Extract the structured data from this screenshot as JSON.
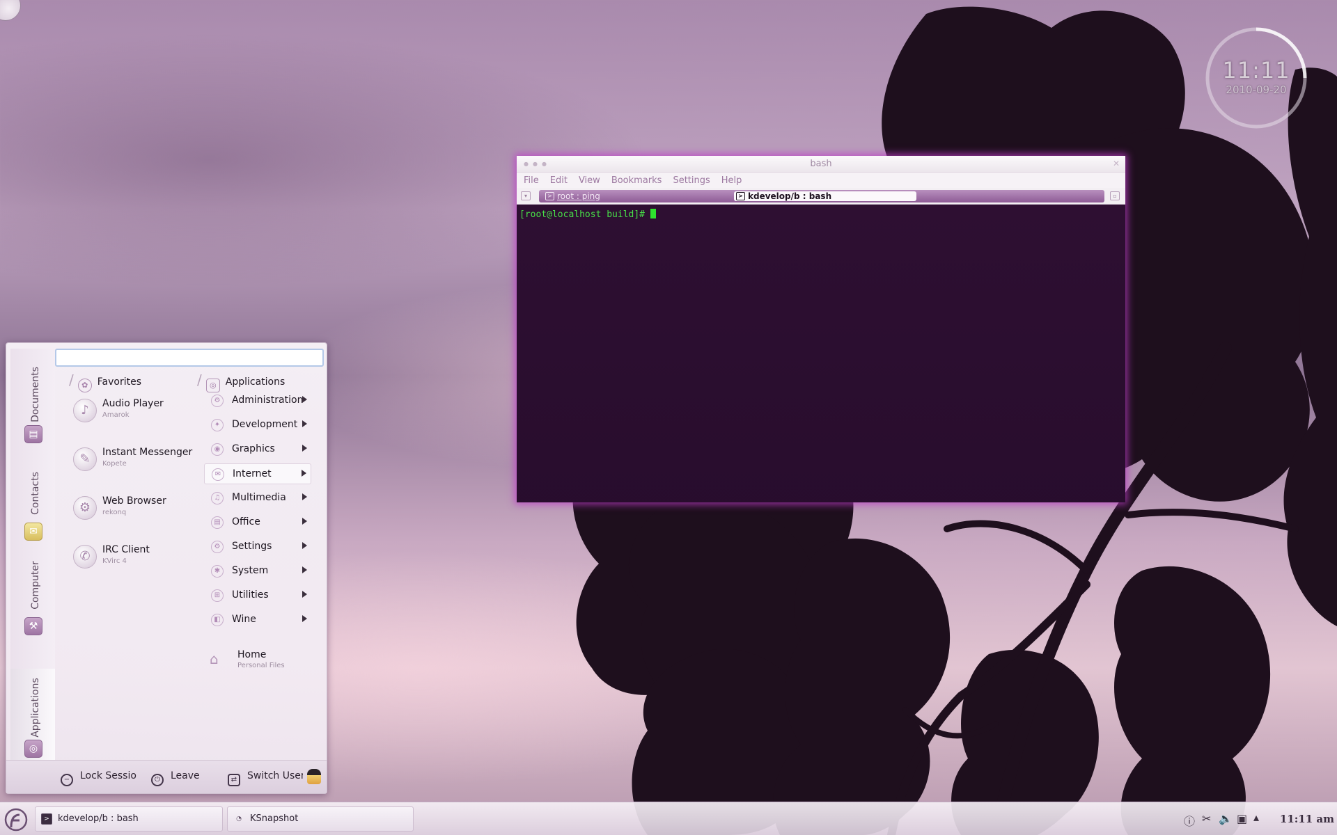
{
  "clock": {
    "time": "11:11",
    "date": "2010-09-20"
  },
  "konsole": {
    "title": "bash",
    "menu": [
      "File",
      "Edit",
      "View",
      "Bookmarks",
      "Settings",
      "Help"
    ],
    "tabs": [
      {
        "label": "root : ping",
        "active": false
      },
      {
        "label": "kdevelop/b : bash",
        "active": true
      }
    ],
    "prompt": "[root@localhost build]# "
  },
  "kickoff": {
    "search": {
      "value": "",
      "placeholder": ""
    },
    "sidebar": [
      {
        "label": "Documents",
        "icon": "documents-icon"
      },
      {
        "label": "Contacts",
        "icon": "contacts-icon"
      },
      {
        "label": "Computer",
        "icon": "computer-icon"
      },
      {
        "label": "Applications",
        "icon": "applications-icon",
        "selected": true
      }
    ],
    "favorites_header": "Favorites",
    "applications_header": "Applications",
    "favorites": [
      {
        "name": "Audio Player",
        "sub": "Amarok",
        "icon": "amarok-icon"
      },
      {
        "name": "Instant Messenger",
        "sub": "Kopete",
        "icon": "kopete-icon"
      },
      {
        "name": "Web Browser",
        "sub": "rekonq",
        "icon": "rekonq-icon"
      },
      {
        "name": "IRC Client",
        "sub": "KVirc 4",
        "icon": "kvirc-icon"
      }
    ],
    "categories": [
      {
        "label": "Administration"
      },
      {
        "label": "Development"
      },
      {
        "label": "Graphics"
      },
      {
        "label": "Internet",
        "hover": true
      },
      {
        "label": "Multimedia"
      },
      {
        "label": "Office"
      },
      {
        "label": "Settings"
      },
      {
        "label": "System"
      },
      {
        "label": "Utilities"
      },
      {
        "label": "Wine"
      }
    ],
    "home": {
      "name": "Home",
      "sub": "Personal Files"
    },
    "bottom": {
      "lock": "Lock Session",
      "leave": "Leave",
      "switch": "Switch User"
    }
  },
  "taskbar": {
    "tasks": [
      {
        "label": "kdevelop/b : bash",
        "icon": "terminal-icon"
      },
      {
        "label": "KSnapshot",
        "icon": "ksnapshot-icon"
      }
    ],
    "clock": "11:11 am"
  }
}
